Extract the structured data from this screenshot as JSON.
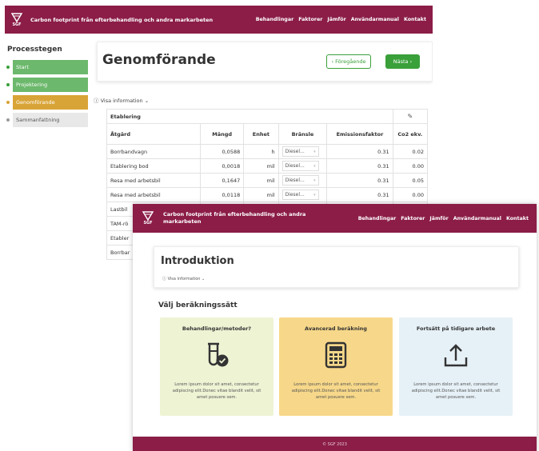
{
  "app": {
    "title": "Carbon footprint från efterbehandling och andra markarbeten",
    "title_front": "Carbon footprint från efterbehandling och andra markarbeten",
    "logo_text": "SGF",
    "nav": [
      "Behandlingar",
      "Faktorer",
      "Jämför",
      "Användarmanual",
      "Kontakt"
    ],
    "brand_color": "#8b1d47"
  },
  "sidebar": {
    "title": "Processtegen",
    "steps": [
      {
        "label": "Start",
        "color": "#6cb86c",
        "dot": "#3aa03a"
      },
      {
        "label": "Projektering",
        "color": "#6cb86c",
        "dot": "#3aa03a"
      },
      {
        "label": "Genomförande",
        "color": "#d9a437",
        "dot": "#d9a437"
      },
      {
        "label": "Sammanfattning",
        "color": "#e8e8e8",
        "dot": "#999999"
      }
    ]
  },
  "page": {
    "title": "Genomförande",
    "prev_label": "‹ Föregående",
    "next_label": "Nästa ›",
    "info_label": "Visa information"
  },
  "table": {
    "section_title": "Etablering",
    "headers": [
      "Åtgärd",
      "Mängd",
      "Enhet",
      "Bränsle",
      "Emissionsfaktor",
      "Co2 ekv."
    ],
    "rows": [
      {
        "atgard": "Borrbandvagn",
        "mangd": "0,0588",
        "enhet": "h",
        "bransle": "Diesel...",
        "ef": "0.31",
        "co2": "0.02"
      },
      {
        "atgard": "Etablering bod",
        "mangd": "0,0018",
        "enhet": "mil",
        "bransle": "Diesel...",
        "ef": "0.31",
        "co2": "0.00"
      },
      {
        "atgard": "Resa med arbetsbil",
        "mangd": "0,1647",
        "enhet": "mil",
        "bransle": "Diesel...",
        "ef": "0.31",
        "co2": "0.05"
      },
      {
        "atgard": "Resa med arbetsbil",
        "mangd": "0,0118",
        "enhet": "mil",
        "bransle": "Diesel...",
        "ef": "0.31",
        "co2": "0.00"
      },
      {
        "atgard": "Lastbil",
        "mangd": "",
        "enhet": "",
        "bransle": "",
        "ef": "",
        "co2": ""
      },
      {
        "atgard": "TAM-rö",
        "mangd": "",
        "enhet": "",
        "bransle": "",
        "ef": "",
        "co2": ""
      },
      {
        "atgard": "Etabler",
        "mangd": "",
        "enhet": "",
        "bransle": "",
        "ef": "",
        "co2": ""
      },
      {
        "atgard": "Borrbar",
        "mangd": "",
        "enhet": "",
        "bransle": "",
        "ef": "",
        "co2": ""
      }
    ]
  },
  "front": {
    "intro_title": "Introduktion",
    "info_label": "Visa information",
    "calc_title": "Välj beräkningssätt",
    "cards": [
      {
        "title": "Behandlingar/metoder?",
        "icon": "test-tube-check-icon",
        "bg": "#eef3d4",
        "body": "Lorem ipsum dolor sit amet, consectetur adipiscing elit.Donec vitae blandit velit, sit amet posuere sem."
      },
      {
        "title": "Avancerad beräkning",
        "icon": "calculator-icon",
        "bg": "#f7d88a",
        "body": "Lorem ipsum dolor sit amet, consectetur adipiscing elit.Donec vitae blandit velit, sit amet posuere sem."
      },
      {
        "title": "Fortsätt på tidigare arbete",
        "icon": "upload-icon",
        "bg": "#e6f1f7",
        "body": "Lorem ipsum dolor sit amet, consectetur adipiscing elit.Donec vitae blandit velit, sit amet posuere sem."
      }
    ],
    "footer": "© SGF 2023"
  }
}
